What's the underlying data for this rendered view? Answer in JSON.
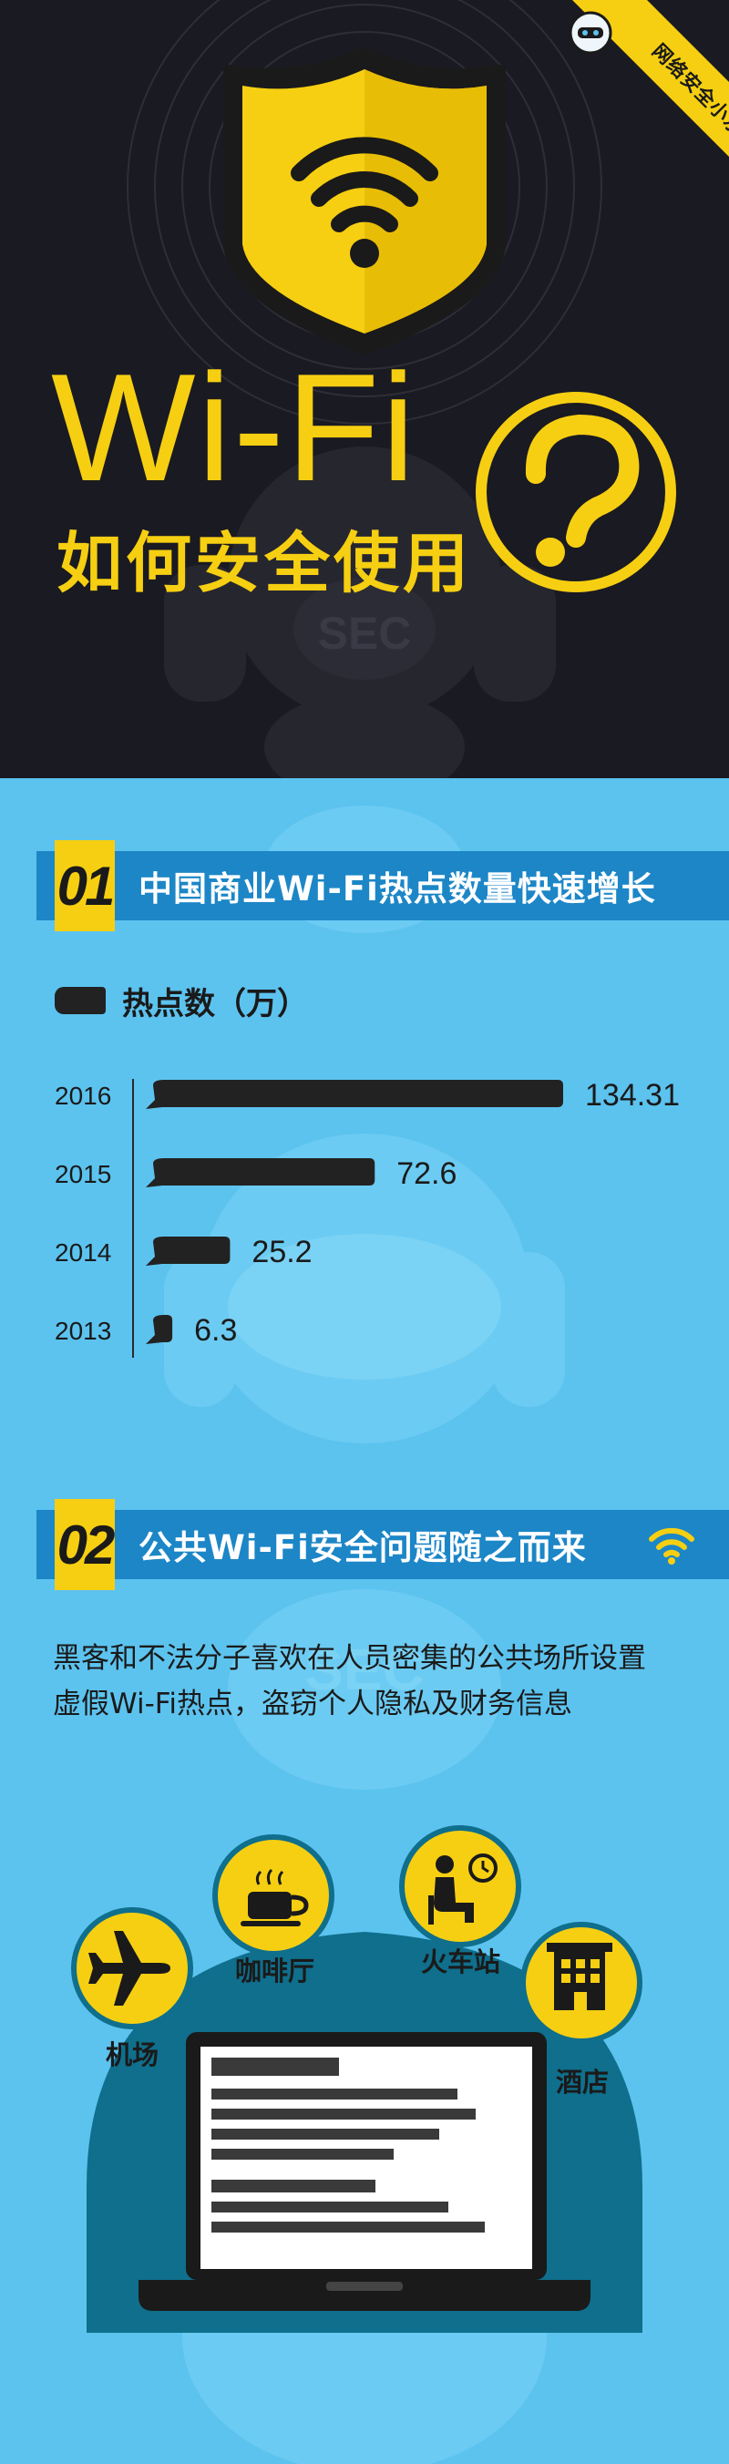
{
  "hero": {
    "ribbon_text": "网络安全小水滴",
    "title": "Wi-Fi",
    "subtitle": "如何安全使用",
    "mascot_text": "SEC"
  },
  "section1": {
    "number": "01",
    "title": "中国商业Wi-Fi热点数量快速增长",
    "icon": "wifi-icon"
  },
  "section2": {
    "number": "02",
    "title": "公共Wi-Fi安全问题随之而来",
    "icon": "wifi-icon",
    "description": [
      "黑客和不法分子喜欢在人员密集的公共场所设置",
      "虚假Wi-Fi热点，盗窃个人隐私及财务信息"
    ],
    "places": [
      {
        "label": "机场",
        "icon": "airplane-icon"
      },
      {
        "label": "咖啡厅",
        "icon": "coffee-cup-icon"
      },
      {
        "label": "火车站",
        "icon": "waiting-passenger-icon"
      },
      {
        "label": "酒店",
        "icon": "hotel-building-icon"
      }
    ],
    "device_icon": "laptop-icon"
  },
  "chart_data": {
    "type": "bar",
    "orientation": "horizontal",
    "legend": "热点数（万）",
    "categories": [
      "2016",
      "2015",
      "2014",
      "2013"
    ],
    "series": [
      {
        "name": "热点数（万）",
        "values": [
          134.31,
          72.6,
          25.2,
          6.3
        ]
      }
    ],
    "value_labels": [
      "134.31",
      "72.6",
      "25.2",
      "6.3"
    ],
    "grid": false
  },
  "colors": {
    "dark_bg": "#1a1a22",
    "accent_yellow": "#f6cf12",
    "sky_blue": "#5cc3ef",
    "header_blue": "#1c86c7",
    "teal": "#0f6f8c",
    "bar": "#222222"
  }
}
